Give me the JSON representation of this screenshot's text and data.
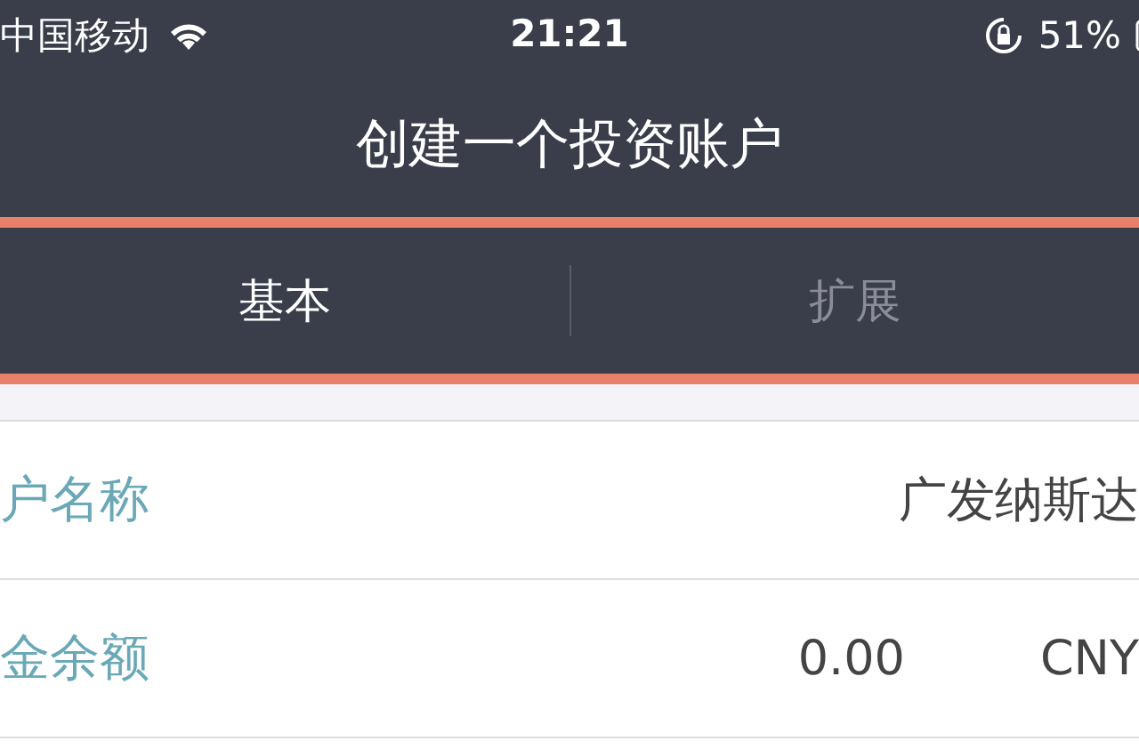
{
  "status_bar": {
    "carrier": "中国移动",
    "time": "21:21",
    "battery": "51%"
  },
  "window": {
    "title": "创建一个投资账户"
  },
  "tabs": [
    {
      "label": "基本",
      "selected": true
    },
    {
      "label": "扩展",
      "selected": false
    }
  ],
  "rows": [
    {
      "label": "户名称",
      "value": "广发纳斯达"
    },
    {
      "label": "金余额",
      "value": "0.00",
      "unit": "CNY"
    }
  ]
}
